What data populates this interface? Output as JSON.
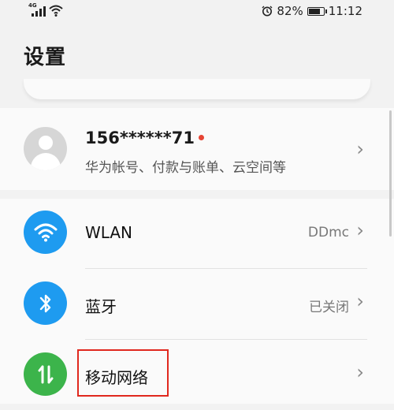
{
  "status_bar": {
    "network_type": "4G",
    "battery_percent": "82%",
    "battery_level": 0.82,
    "time": "11:12"
  },
  "page": {
    "title": "设置"
  },
  "account": {
    "name": "156******71",
    "subtitle": "华为帐号、付款与账单、云空间等"
  },
  "items": [
    {
      "label": "WLAN",
      "value": "DDmc",
      "icon": "wifi-icon",
      "color": "#1e9bf0"
    },
    {
      "label": "蓝牙",
      "value": "已关闭",
      "icon": "bluetooth-icon",
      "color": "#1e9bf0"
    },
    {
      "label": "移动网络",
      "value": "",
      "icon": "mobile-data-icon",
      "color": "#3cb44b"
    }
  ],
  "colors": {
    "background": "#f2f2f2",
    "card": "#fafafa",
    "badge_red": "#e64434",
    "highlight": "#e0281e"
  }
}
